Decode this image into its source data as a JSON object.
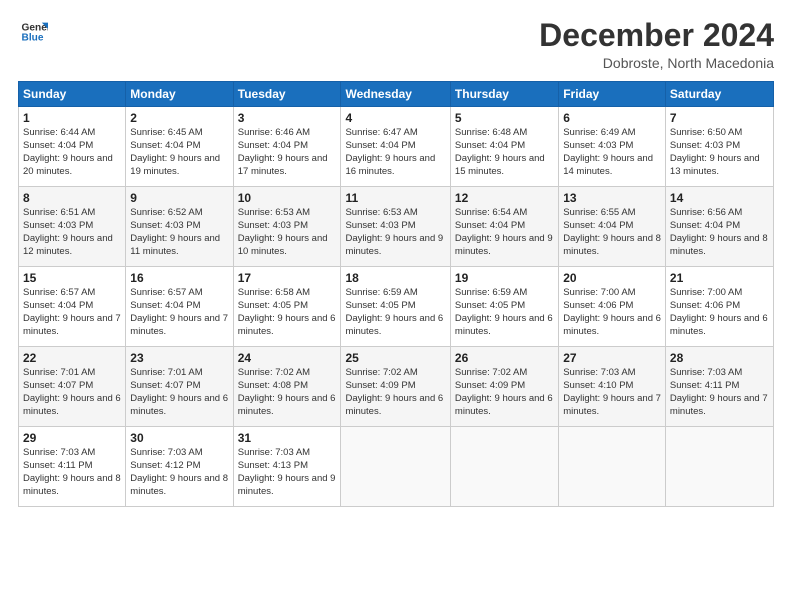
{
  "header": {
    "logo_line1": "General",
    "logo_line2": "Blue",
    "title": "December 2024",
    "subtitle": "Dobroste, North Macedonia"
  },
  "days_of_week": [
    "Sunday",
    "Monday",
    "Tuesday",
    "Wednesday",
    "Thursday",
    "Friday",
    "Saturday"
  ],
  "weeks": [
    [
      {
        "day": "1",
        "sunrise": "6:44 AM",
        "sunset": "4:04 PM",
        "daylight": "9 hours and 20 minutes."
      },
      {
        "day": "2",
        "sunrise": "6:45 AM",
        "sunset": "4:04 PM",
        "daylight": "9 hours and 19 minutes."
      },
      {
        "day": "3",
        "sunrise": "6:46 AM",
        "sunset": "4:04 PM",
        "daylight": "9 hours and 17 minutes."
      },
      {
        "day": "4",
        "sunrise": "6:47 AM",
        "sunset": "4:04 PM",
        "daylight": "9 hours and 16 minutes."
      },
      {
        "day": "5",
        "sunrise": "6:48 AM",
        "sunset": "4:04 PM",
        "daylight": "9 hours and 15 minutes."
      },
      {
        "day": "6",
        "sunrise": "6:49 AM",
        "sunset": "4:03 PM",
        "daylight": "9 hours and 14 minutes."
      },
      {
        "day": "7",
        "sunrise": "6:50 AM",
        "sunset": "4:03 PM",
        "daylight": "9 hours and 13 minutes."
      }
    ],
    [
      {
        "day": "8",
        "sunrise": "6:51 AM",
        "sunset": "4:03 PM",
        "daylight": "9 hours and 12 minutes."
      },
      {
        "day": "9",
        "sunrise": "6:52 AM",
        "sunset": "4:03 PM",
        "daylight": "9 hours and 11 minutes."
      },
      {
        "day": "10",
        "sunrise": "6:53 AM",
        "sunset": "4:03 PM",
        "daylight": "9 hours and 10 minutes."
      },
      {
        "day": "11",
        "sunrise": "6:53 AM",
        "sunset": "4:03 PM",
        "daylight": "9 hours and 9 minutes."
      },
      {
        "day": "12",
        "sunrise": "6:54 AM",
        "sunset": "4:04 PM",
        "daylight": "9 hours and 9 minutes."
      },
      {
        "day": "13",
        "sunrise": "6:55 AM",
        "sunset": "4:04 PM",
        "daylight": "9 hours and 8 minutes."
      },
      {
        "day": "14",
        "sunrise": "6:56 AM",
        "sunset": "4:04 PM",
        "daylight": "9 hours and 8 minutes."
      }
    ],
    [
      {
        "day": "15",
        "sunrise": "6:57 AM",
        "sunset": "4:04 PM",
        "daylight": "9 hours and 7 minutes."
      },
      {
        "day": "16",
        "sunrise": "6:57 AM",
        "sunset": "4:04 PM",
        "daylight": "9 hours and 7 minutes."
      },
      {
        "day": "17",
        "sunrise": "6:58 AM",
        "sunset": "4:05 PM",
        "daylight": "9 hours and 6 minutes."
      },
      {
        "day": "18",
        "sunrise": "6:59 AM",
        "sunset": "4:05 PM",
        "daylight": "9 hours and 6 minutes."
      },
      {
        "day": "19",
        "sunrise": "6:59 AM",
        "sunset": "4:05 PM",
        "daylight": "9 hours and 6 minutes."
      },
      {
        "day": "20",
        "sunrise": "7:00 AM",
        "sunset": "4:06 PM",
        "daylight": "9 hours and 6 minutes."
      },
      {
        "day": "21",
        "sunrise": "7:00 AM",
        "sunset": "4:06 PM",
        "daylight": "9 hours and 6 minutes."
      }
    ],
    [
      {
        "day": "22",
        "sunrise": "7:01 AM",
        "sunset": "4:07 PM",
        "daylight": "9 hours and 6 minutes."
      },
      {
        "day": "23",
        "sunrise": "7:01 AM",
        "sunset": "4:07 PM",
        "daylight": "9 hours and 6 minutes."
      },
      {
        "day": "24",
        "sunrise": "7:02 AM",
        "sunset": "4:08 PM",
        "daylight": "9 hours and 6 minutes."
      },
      {
        "day": "25",
        "sunrise": "7:02 AM",
        "sunset": "4:09 PM",
        "daylight": "9 hours and 6 minutes."
      },
      {
        "day": "26",
        "sunrise": "7:02 AM",
        "sunset": "4:09 PM",
        "daylight": "9 hours and 6 minutes."
      },
      {
        "day": "27",
        "sunrise": "7:03 AM",
        "sunset": "4:10 PM",
        "daylight": "9 hours and 7 minutes."
      },
      {
        "day": "28",
        "sunrise": "7:03 AM",
        "sunset": "4:11 PM",
        "daylight": "9 hours and 7 minutes."
      }
    ],
    [
      {
        "day": "29",
        "sunrise": "7:03 AM",
        "sunset": "4:11 PM",
        "daylight": "9 hours and 8 minutes."
      },
      {
        "day": "30",
        "sunrise": "7:03 AM",
        "sunset": "4:12 PM",
        "daylight": "9 hours and 8 minutes."
      },
      {
        "day": "31",
        "sunrise": "7:03 AM",
        "sunset": "4:13 PM",
        "daylight": "9 hours and 9 minutes."
      },
      null,
      null,
      null,
      null
    ]
  ]
}
